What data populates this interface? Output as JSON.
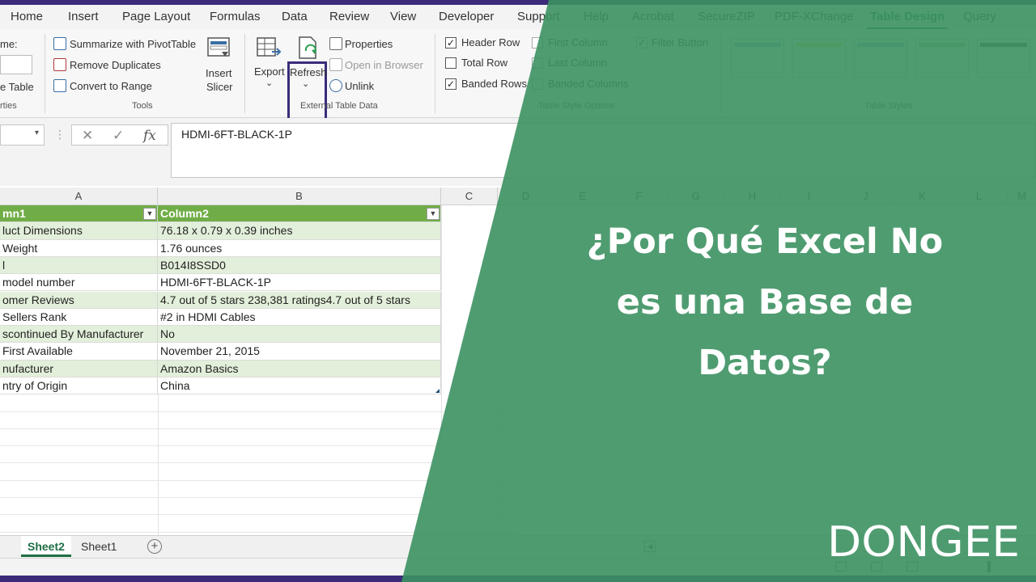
{
  "ribbon": {
    "tabs": [
      "Home",
      "Insert",
      "Page Layout",
      "Formulas",
      "Data",
      "Review",
      "View",
      "Developer",
      "Support",
      "Help",
      "Acrobat",
      "SecureZIP",
      "PDF-XChange",
      "Table Design",
      "Query"
    ],
    "active_tab": "Table Design",
    "properties_group": {
      "name_label_fragment": "me:",
      "resize_fragment": "e Table",
      "group_label_fragment": "rties"
    },
    "tools": {
      "summarize": "Summarize with PivotTable",
      "remove_duplicates": "Remove Duplicates",
      "convert_to_range": "Convert to Range",
      "insert_slicer_line1": "Insert",
      "insert_slicer_line2": "Slicer",
      "group_label": "Tools"
    },
    "external": {
      "export": "Export",
      "refresh": "Refresh",
      "properties": "Properties",
      "open_in_browser": "Open in Browser",
      "unlink": "Unlink",
      "group_label": "External Table Data"
    },
    "style_options": {
      "header_row": "Header Row",
      "total_row": "Total Row",
      "banded_rows": "Banded Rows",
      "first_column": "First Column",
      "last_column": "Last Column",
      "banded_columns": "Banded Columns",
      "filter_button": "Filter Button",
      "header_row_checked": true,
      "total_row_checked": false,
      "banded_rows_checked": true,
      "first_column_checked": false,
      "last_column_checked": false,
      "banded_columns_checked": false,
      "filter_button_checked": true,
      "group_label": "Table Style Options"
    },
    "table_styles": {
      "group_label": "Table Styles",
      "swatch_colors": [
        "#9dc3e6",
        "#ffd966",
        "#9dc3e6",
        "#a9d18e",
        "#5a5a5a"
      ]
    }
  },
  "formula_bar": {
    "value": "HDMI-6FT-BLACK-1P",
    "cancel_glyph": "✕",
    "enter_glyph": "✓",
    "fx_glyph": "fx"
  },
  "grid": {
    "column_letters": [
      "A",
      "B",
      "C",
      "D",
      "E",
      "F",
      "G",
      "H",
      "I",
      "J",
      "K",
      "L",
      "M"
    ],
    "headers": [
      "mn1",
      "Column2"
    ],
    "rows": [
      [
        "luct Dimensions",
        "76.18 x 0.79 x 0.39 inches"
      ],
      [
        " Weight",
        "1.76 ounces"
      ],
      [
        "l",
        "B014I8SSD0"
      ],
      [
        " model number",
        "HDMI-6FT-BLACK-1P"
      ],
      [
        "omer Reviews",
        "4.7 out of 5 stars 238,381 ratings4.7 out of 5 stars"
      ],
      [
        " Sellers Rank",
        "#2 in HDMI Cables"
      ],
      [
        "scontinued By Manufacturer",
        "No"
      ],
      [
        " First Available",
        "November 21, 2015"
      ],
      [
        "nufacturer",
        "Amazon Basics"
      ],
      [
        "ntry of Origin",
        "China"
      ]
    ]
  },
  "sheets": {
    "tabs": [
      "Sheet2",
      "Sheet1"
    ],
    "active": "Sheet2"
  },
  "overlay": {
    "headline_line1": "¿Por Qué Excel No",
    "headline_line2": "es una Base de",
    "headline_line3": "Datos?",
    "brand": "DONGEE",
    "green_color": "#3c9162"
  }
}
